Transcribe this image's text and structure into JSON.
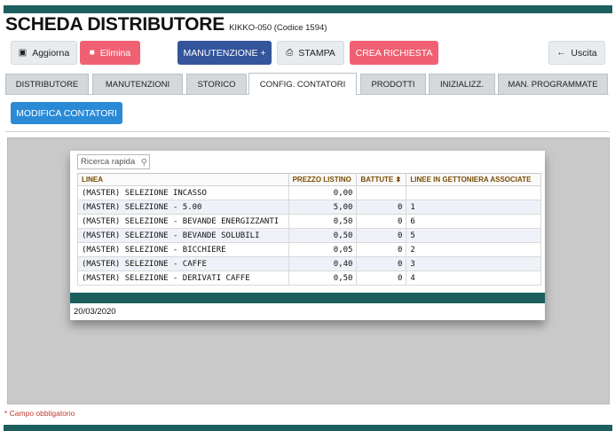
{
  "header": {
    "title": "SCHEDA DISTRIBUTORE",
    "subtitle": "KIKKO-050 (Codice 1594)"
  },
  "toolbar": {
    "refresh_label": "Aggiorna",
    "delete_label": "Elimina",
    "maintenance_label": "MANUTENZIONE +",
    "print_label": "STAMPA",
    "create_request_label": "CREA RICHIESTA",
    "exit_label": "Uscita"
  },
  "tabs": [
    {
      "label": "DISTRIBUTORE"
    },
    {
      "label": "MANUTENZIONI"
    },
    {
      "label": "STORICO"
    },
    {
      "label": "CONFIG. CONTATORI"
    },
    {
      "label": "PRODOTTI"
    },
    {
      "label": "INIZIALIZZ."
    },
    {
      "label": "MAN. PROGRAMMATE"
    }
  ],
  "active_tab": "CONFIG. CONTATORI",
  "action": {
    "edit_counters_label": "MODIFICA CONTATORI"
  },
  "grid": {
    "search_placeholder": "Ricerca rapida",
    "columns": {
      "linea": "LINEA",
      "prezzo": "PREZZO LISTINO",
      "battute": "BATTUTE",
      "linee_gettoniera": "LINEE IN GETTONIERA ASSOCIATE"
    },
    "rows": [
      {
        "linea": "(MASTER) SELEZIONE INCASSO",
        "prezzo": "0,00",
        "battute": "",
        "linee": ""
      },
      {
        "linea": "(MASTER) SELEZIONE - 5.00",
        "prezzo": "5,00",
        "battute": "0",
        "linee": "1"
      },
      {
        "linea": "(MASTER) SELEZIONE - BEVANDE ENERGIZZANTI",
        "prezzo": "0,50",
        "battute": "0",
        "linee": "6"
      },
      {
        "linea": "(MASTER) SELEZIONE - BEVANDE SOLUBILI",
        "prezzo": "0,50",
        "battute": "0",
        "linee": "5"
      },
      {
        "linea": "(MASTER) SELEZIONE - BICCHIERE",
        "prezzo": "0,05",
        "battute": "0",
        "linee": "2"
      },
      {
        "linea": "(MASTER) SELEZIONE - CAFFE",
        "prezzo": "0,40",
        "battute": "0",
        "linee": "3"
      },
      {
        "linea": "(MASTER) SELEZIONE - DERIVATI CAFFE",
        "prezzo": "0,50",
        "battute": "0",
        "linee": "4"
      }
    ],
    "date": "20/03/2020"
  },
  "footer": {
    "required_note": "* Campo obbligatorio"
  },
  "colors": {
    "accent_teal": "#1c5f5e",
    "button_pink": "#f06073",
    "button_navy": "#34559b",
    "button_blue": "#2b8ad6"
  }
}
